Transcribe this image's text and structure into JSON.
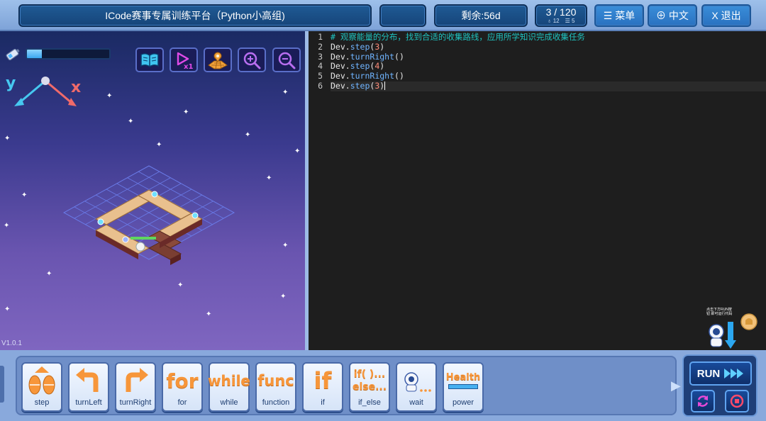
{
  "topbar": {
    "title": "ICode赛事专属训练平台（Python小高组)",
    "remaining": "剩余:56d",
    "level": "3 / 120",
    "level_sub_a": "12",
    "level_sub_b": "5",
    "menu_label": "☰ 菜单",
    "lang_label": "⊕ 中文",
    "exit_label": "X 退出"
  },
  "game": {
    "energy_level": 0.18,
    "axis_y": "y",
    "axis_x": "x",
    "version": "V1.0.1",
    "tools": [
      "book-icon",
      "speed-icon",
      "map-icon",
      "zoom-in-icon",
      "zoom-out-icon"
    ]
  },
  "editor": {
    "lines": [
      {
        "n": "1",
        "parts": [
          {
            "t": "comment",
            "v": "# 观察能量的分布，找到合适的收集路线，应用所学知识完成收集任务"
          }
        ]
      },
      {
        "n": "2",
        "parts": [
          {
            "t": "plain",
            "v": "Dev."
          },
          {
            "t": "fn",
            "v": "step"
          },
          {
            "t": "plain",
            "v": "("
          },
          {
            "t": "num",
            "v": "3"
          },
          {
            "t": "plain",
            "v": ")"
          }
        ]
      },
      {
        "n": "3",
        "parts": [
          {
            "t": "plain",
            "v": "Dev."
          },
          {
            "t": "fn",
            "v": "turnRight"
          },
          {
            "t": "plain",
            "v": "()"
          }
        ]
      },
      {
        "n": "4",
        "parts": [
          {
            "t": "plain",
            "v": "Dev."
          },
          {
            "t": "fn",
            "v": "step"
          },
          {
            "t": "plain",
            "v": "("
          },
          {
            "t": "num",
            "v": "4"
          },
          {
            "t": "plain",
            "v": ")"
          }
        ]
      },
      {
        "n": "5",
        "parts": [
          {
            "t": "plain",
            "v": "Dev."
          },
          {
            "t": "fn",
            "v": "turnRight"
          },
          {
            "t": "plain",
            "v": "()"
          }
        ]
      },
      {
        "n": "6",
        "parts": [
          {
            "t": "plain",
            "v": "Dev."
          },
          {
            "t": "fn",
            "v": "step"
          },
          {
            "t": "plain",
            "v": "("
          },
          {
            "t": "num",
            "v": "3"
          },
          {
            "t": "plain",
            "v": ")"
          }
        ]
      }
    ]
  },
  "helper": {
    "hint": "点击下方RUN按钮 即可运行代码"
  },
  "commands": [
    {
      "id": "step",
      "label": "step",
      "icon": "step-icon"
    },
    {
      "id": "turnLeft",
      "label": "turnLeft",
      "icon": "turn-left-icon"
    },
    {
      "id": "turnRight",
      "label": "turnRight",
      "icon": "turn-right-icon"
    },
    {
      "id": "for",
      "label": "for",
      "icon_text": "for"
    },
    {
      "id": "while",
      "label": "while",
      "icon_text": "while"
    },
    {
      "id": "function",
      "label": "function",
      "icon_text": "func"
    },
    {
      "id": "if",
      "label": "if",
      "icon_text": "if"
    },
    {
      "id": "if_else",
      "label": "if_else",
      "icon_text": "if( )...",
      "icon_text2": "else..."
    },
    {
      "id": "wait",
      "label": "wait",
      "icon": "robot-icon"
    },
    {
      "id": "power",
      "label": "power",
      "icon_text": "Health"
    }
  ],
  "run": {
    "label": "RUN"
  },
  "colors": {
    "accent": "#3a8ed9",
    "comment": "#1fc2bf",
    "function": "#6fb4ff",
    "number": "#ff8d7a",
    "command_word": "#f7963a"
  }
}
